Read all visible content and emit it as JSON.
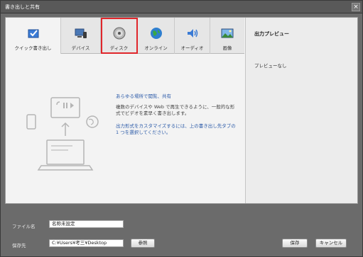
{
  "window": {
    "title": "書き出しと共有"
  },
  "tabs": [
    {
      "label": "クイック書き出し",
      "icon": "quick-export-icon"
    },
    {
      "label": "デバイス",
      "icon": "device-icon"
    },
    {
      "label": "ディスク",
      "icon": "disc-icon"
    },
    {
      "label": "オンライン",
      "icon": "globe-icon"
    },
    {
      "label": "オーディオ",
      "icon": "speaker-icon"
    },
    {
      "label": "画像",
      "icon": "image-icon"
    }
  ],
  "active_tab": "クイック書き出し",
  "highlighted_tab": "ディスク",
  "content": {
    "headline": "あらゆる場所で閲覧、共有",
    "body": "複数のデバイスや Web で再生できるように、一般的な形式でビデオを素早く書き出します。",
    "hint": "出力形式をカスタマイズするには、上の書き出し先タブの 1 つを選択してください。"
  },
  "preview": {
    "title": "出力プレビュー",
    "empty_text": "プレビューなし"
  },
  "footer": {
    "filename_label": "ファイル名",
    "filename_value": "名称未設定",
    "location_label": "保存先",
    "location_value": "C:¥Users¥考三¥Desktop",
    "browse_label": "参照",
    "save_label": "保存",
    "cancel_label": "キャンセル"
  },
  "colors": {
    "highlight_border": "#e0262b",
    "link_text": "#2b5aa8",
    "chrome": "#6b6b6b"
  }
}
